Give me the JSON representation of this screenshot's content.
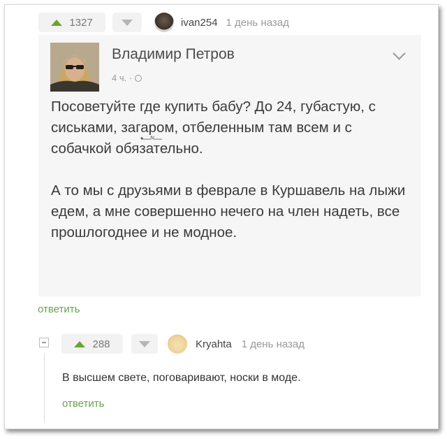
{
  "top_comment": {
    "votes": "1327",
    "username": "ivan254",
    "time": "1 день назад",
    "reply_label": "ответить"
  },
  "post": {
    "author": "Владимир Петров",
    "meta": "4 ч. · ",
    "paragraph1": "Посоветуйте где купить бабу? До 24, губастую, с сиськами, загаром, отбеленным там всем и с собачкой обязательно.",
    "emoji_art": "•—ʳᵛ—",
    "paragraph2": "А то мы с друзьями в феврале в Куршавель на лыжи едем, а мне совершенно нечего на член надеть, все прошлогоднее и не модное."
  },
  "reply_comment": {
    "votes": "288",
    "username": "Kryahta",
    "time": "1 день назад",
    "text": "В высшем свете, поговаривают, носки в моде.",
    "reply_label": "ответить"
  },
  "colors": {
    "upvote": "#6aa52f",
    "reply_link": "#66a34a"
  }
}
